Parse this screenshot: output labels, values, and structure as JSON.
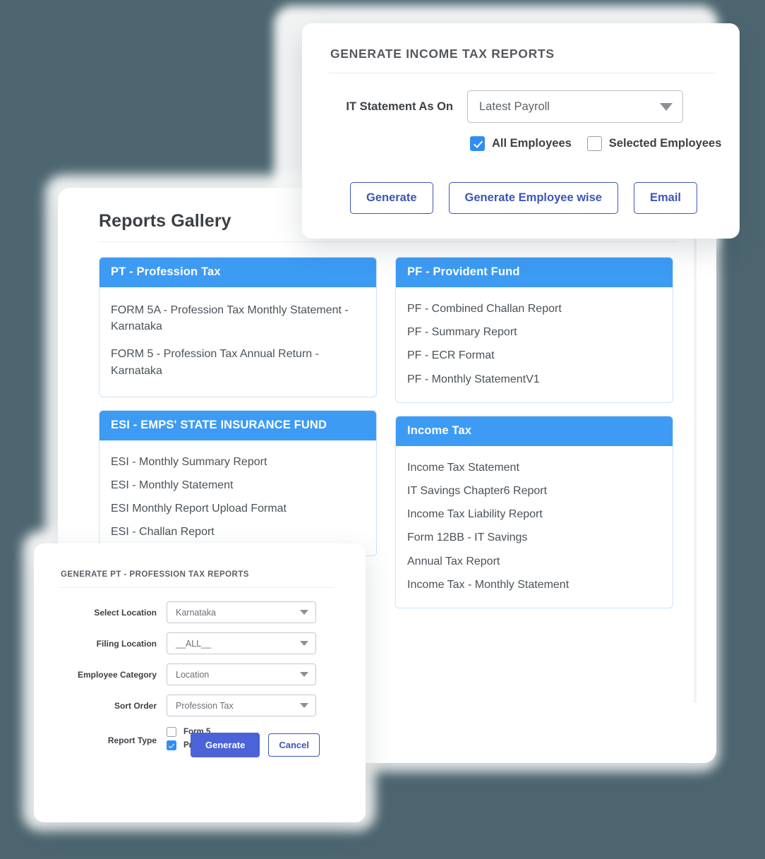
{
  "theme": {
    "page_background": "#4d6670",
    "card_header_blue": "#3d9bf4",
    "checkbox_blue": "#2f8ef4",
    "button_outline_blue": "#3c56b5",
    "button_primary_blue": "#4b63d6"
  },
  "income_tax_dialog": {
    "title": "GENERATE INCOME TAX REPORTS",
    "statement_label": "IT Statement As On",
    "statement_select": {
      "value": "Latest Payroll",
      "icon": "chevron-down-icon"
    },
    "checkboxes": [
      {
        "label": "All Employees",
        "checked": true
      },
      {
        "label": "Selected Employees",
        "checked": false
      }
    ],
    "buttons": [
      {
        "label": "Generate"
      },
      {
        "label": "Generate Employee wise"
      },
      {
        "label": "Email"
      }
    ]
  },
  "gallery": {
    "title": "Reports Gallery",
    "columns": [
      {
        "cards": [
          {
            "header": "PT - Profession Tax",
            "items": [
              "FORM 5A - Profession Tax Monthly Statement - Karnataka",
              "FORM 5 - Profession Tax Annual Return - Karnataka"
            ]
          },
          {
            "header": "ESI - EMPS' STATE INSURANCE FUND",
            "items": [
              "ESI - Monthly Summary Report",
              "ESI - Monthly Statement",
              "ESI Monthly Report Upload Format",
              "ESI - Challan Report"
            ]
          }
        ]
      },
      {
        "cards": [
          {
            "header": "PF - Provident Fund",
            "items": [
              "PF - Combined Challan Report",
              "PF - Summary Report",
              "PF - ECR Format",
              "PF - Monthly StatementV1"
            ]
          },
          {
            "header": "Income Tax",
            "items": [
              "Income Tax Statement",
              "IT Savings Chapter6 Report",
              "Income Tax Liability Report",
              "Form 12BB - IT Savings",
              "Annual Tax Report",
              "Income Tax - Monthly Statement"
            ]
          }
        ]
      }
    ]
  },
  "pt_dialog": {
    "title": "GENERATE PT - PROFESSION TAX REPORTS",
    "fields": [
      {
        "label": "Select Location",
        "value": "Karnataka",
        "icon": "chevron-down-icon"
      },
      {
        "label": "Filing Location",
        "value": "__ALL__",
        "icon": "chevron-down-icon"
      },
      {
        "label": "Employee Category",
        "value": "Location",
        "icon": "chevron-down-icon"
      },
      {
        "label": "Sort Order",
        "value": "Profession Tax",
        "icon": "chevron-down-icon"
      }
    ],
    "report_type": {
      "label": "Report Type",
      "options": [
        {
          "label": "Form 5",
          "checked": false
        },
        {
          "label": "Prof.Statement",
          "checked": true
        }
      ]
    },
    "buttons": {
      "generate": "Generate",
      "cancel": "Cancel"
    }
  }
}
